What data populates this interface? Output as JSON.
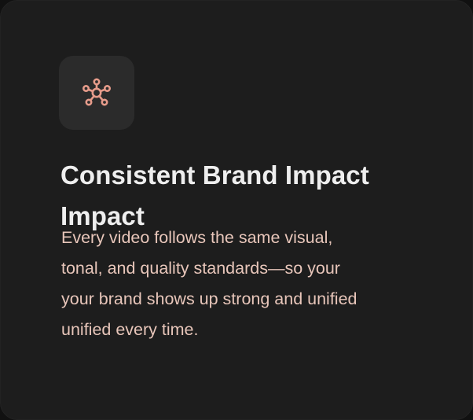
{
  "card": {
    "icon": "network-hub-icon",
    "accent_color": "#e79c8b",
    "title_lines": [
      "Consistent Brand Impact",
      "Impact"
    ],
    "description_lines": [
      "Every video follows the same visual,",
      "tonal, and quality standards—so your",
      "your brand shows up strong and unified",
      "unified every time."
    ]
  }
}
